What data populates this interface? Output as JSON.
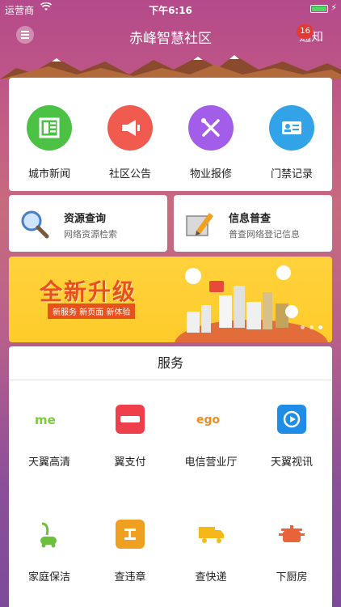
{
  "status_bar": {
    "carrier": "运营商",
    "time": "下午6:16"
  },
  "nav": {
    "title": "赤峰智慧社区",
    "notify_label": "通知",
    "badge_count": "16"
  },
  "quick_actions": [
    {
      "label": "城市新闻",
      "icon": "newspaper-icon",
      "color": "#4cc244"
    },
    {
      "label": "社区公告",
      "icon": "megaphone-icon",
      "color": "#f05a4f"
    },
    {
      "label": "物业报修",
      "icon": "tools-icon",
      "color": "#a25ee8"
    },
    {
      "label": "门禁记录",
      "icon": "id-card-icon",
      "color": "#33a3e8"
    }
  ],
  "info_cards": [
    {
      "title": "资源查询",
      "subtitle": "网络资源检索",
      "icon": "magnifier-icon"
    },
    {
      "title": "信息普查",
      "subtitle": "普查网络登记信息",
      "icon": "pencil-icon"
    }
  ],
  "banner": {
    "headline": "全新升级",
    "tags": "新服务  新页面  新体验",
    "slides": 3,
    "active_slide": 3
  },
  "services": {
    "title": "服务",
    "items": [
      {
        "label": "天翼高清",
        "icon": "tianyi-hd-icon",
        "color": "#7ccc3a"
      },
      {
        "label": "翼支付",
        "icon": "yizhifu-icon",
        "color": "#ee3f4a"
      },
      {
        "label": "电信营业厅",
        "icon": "ego-icon",
        "color": "#f08a24"
      },
      {
        "label": "天翼视讯",
        "icon": "video-play-icon",
        "color": "#1f8ce6"
      },
      {
        "label": "家庭保洁",
        "icon": "vacuum-icon",
        "color": "#6cc040"
      },
      {
        "label": "查违章",
        "icon": "traffic-violation-icon",
        "color": "#f0a020"
      },
      {
        "label": "查快递",
        "icon": "truck-icon",
        "color": "#f6b818"
      },
      {
        "label": "下厨房",
        "icon": "pot-icon",
        "color": "#e8623a"
      }
    ]
  }
}
